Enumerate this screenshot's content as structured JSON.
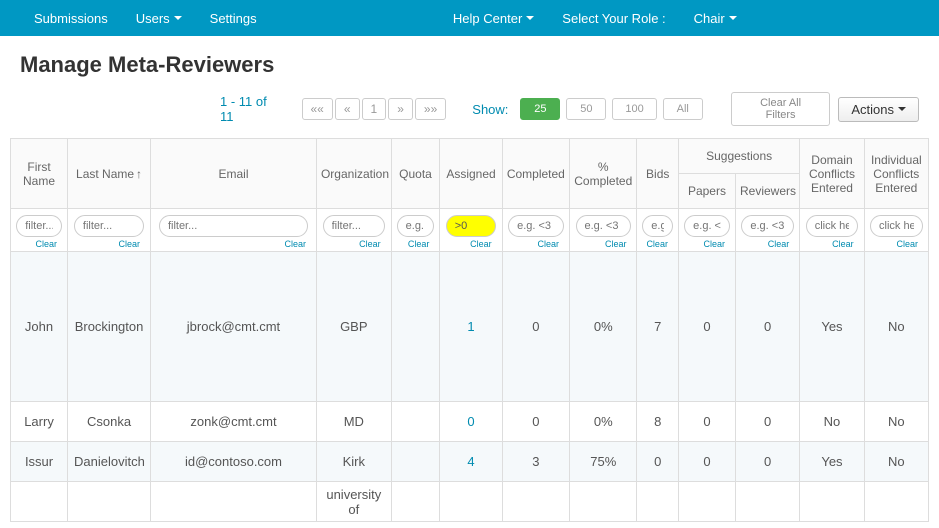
{
  "nav": {
    "submissions": "Submissions",
    "users": "Users",
    "settings": "Settings",
    "help": "Help Center",
    "roleLabel": "Select Your Role :",
    "role": "Chair"
  },
  "pageTitle": "Manage Meta-Reviewers",
  "pager": {
    "info": "1 - 11 of 11",
    "first": "««",
    "prev": "«",
    "page": "1",
    "next": "»",
    "last": "»»"
  },
  "show": {
    "label": "Show:",
    "b25": "25",
    "b50": "50",
    "b100": "100",
    "bAll": "All"
  },
  "clearAll": "Clear All Filters",
  "actions": "Actions",
  "headers": {
    "first": "First Name",
    "last": "Last Name",
    "email": "Email",
    "org": "Organization",
    "quota": "Quota",
    "assigned": "Assigned",
    "completed": "Completed",
    "pct": "% Completed",
    "bids": "Bids",
    "suggestions": "Suggestions",
    "sugPapers": "Papers",
    "sugReviewers": "Reviewers",
    "domain": "Domain Conflicts Entered",
    "individual": "Individual Conflicts Entered"
  },
  "filters": {
    "ph_filter": "filter...",
    "ph_eg": "e.g. <3",
    "ph_click": "click here",
    "assigned_value": ">0",
    "clear": "Clear"
  },
  "rows": [
    {
      "first": "John",
      "last": "Brockington",
      "email": "jbrock@cmt.cmt",
      "org": "GBP",
      "quota": "",
      "assigned": "1",
      "completed": "0",
      "pct": "0%",
      "bids": "7",
      "sugP": "0",
      "sugR": "0",
      "domain": "Yes",
      "individual": "No"
    },
    {
      "first": "Larry",
      "last": "Csonka",
      "email": "zonk@cmt.cmt",
      "org": "MD",
      "quota": "",
      "assigned": "0",
      "completed": "0",
      "pct": "0%",
      "bids": "8",
      "sugP": "0",
      "sugR": "0",
      "domain": "No",
      "individual": "No"
    },
    {
      "first": "Issur",
      "last": "Danielovitch",
      "email": "id@contoso.com",
      "org": "Kirk",
      "quota": "",
      "assigned": "4",
      "completed": "3",
      "pct": "75%",
      "bids": "0",
      "sugP": "0",
      "sugR": "0",
      "domain": "Yes",
      "individual": "No"
    },
    {
      "first": "",
      "last": "",
      "email": "",
      "org": "university of",
      "quota": "",
      "assigned": "",
      "completed": "",
      "pct": "",
      "bids": "",
      "sugP": "",
      "sugR": "",
      "domain": "",
      "individual": ""
    }
  ]
}
